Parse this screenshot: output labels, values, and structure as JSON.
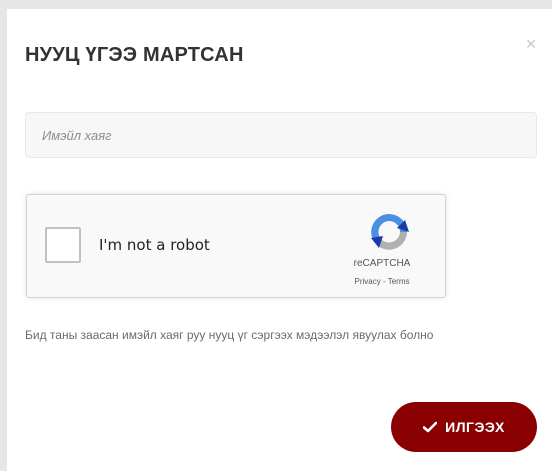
{
  "modal": {
    "title": "НУУЦ ҮГЭЭ МАРТСАН",
    "close_symbol": "×"
  },
  "email": {
    "placeholder": "Имэйл хаяг",
    "value": ""
  },
  "recaptcha": {
    "label": "I'm not a robot",
    "brand": "reCAPTCHA",
    "privacy": "Privacy",
    "separator": " - ",
    "terms": "Terms",
    "checked": false,
    "icon": "recaptcha-logo-icon"
  },
  "info": {
    "text": "Бид таны заасан имэйл хаяг руу нууц үг сэргээх мэдээлэл явуулах болно"
  },
  "submit": {
    "label": "ИЛГЭЭХ",
    "icon": "check-icon",
    "color": "#8b0000"
  },
  "colors": {
    "backdrop": "#e6e6e6",
    "modal_bg": "#ffffff",
    "input_bg": "#f7f7f7",
    "accent": "#8b0000"
  }
}
